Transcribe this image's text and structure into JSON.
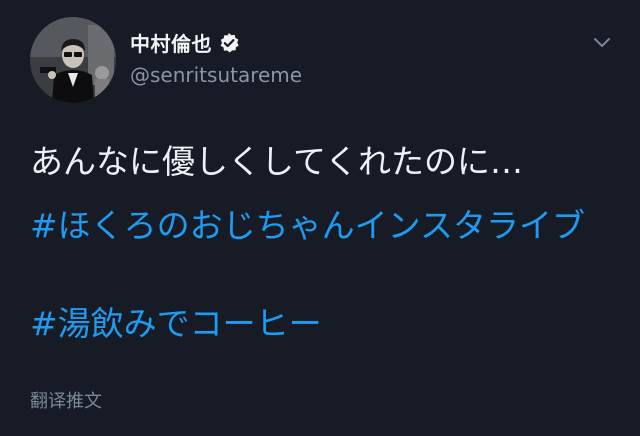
{
  "tweet": {
    "author": {
      "display_name": "中村倫也",
      "handle": "@senritsutareme",
      "verified_badge": "verified-badge-icon",
      "avatar": "avatar-photo"
    },
    "menu_icon": "chevron-down-icon",
    "text": "あんなに優しくしてくれたのに…",
    "hashtags": [
      "#ほくろのおじちゃんインスタライブ",
      "#湯飲みでコーヒー"
    ],
    "translate_label": "翻译推文"
  },
  "colors": {
    "background": "#161b26",
    "link": "#1d9bf0",
    "secondary_text": "#8a96a3",
    "primary_text": "#eef1f4"
  }
}
